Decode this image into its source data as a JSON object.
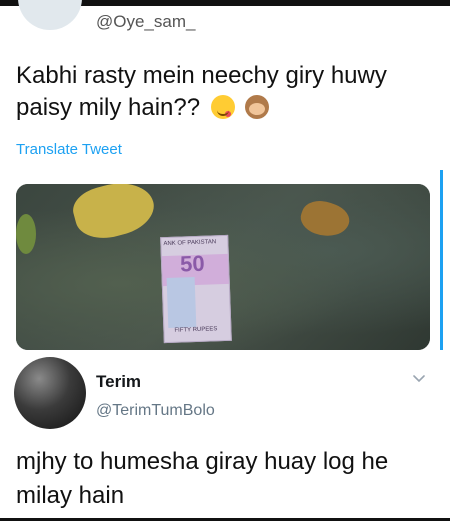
{
  "original_tweet": {
    "handle": "@Oye_sam_",
    "text": "Kabhi rasty mein neechy giry huwy paisy mily hain??",
    "emojis": [
      "yum-face",
      "see-no-evil-monkey"
    ],
    "translate_label": "Translate Tweet",
    "photo_note_top": "ANK OF PAKISTAN",
    "photo_note_value": "50",
    "photo_note_bottom": "FIFTY RUPEES"
  },
  "reply_tweet": {
    "name": "Terim",
    "handle": "@TerimTumBolo",
    "text": "mjhy to humesha giray huay log he milay hain"
  },
  "colors": {
    "link": "#1da1f2",
    "handle": "#657786",
    "text": "#14171a"
  }
}
